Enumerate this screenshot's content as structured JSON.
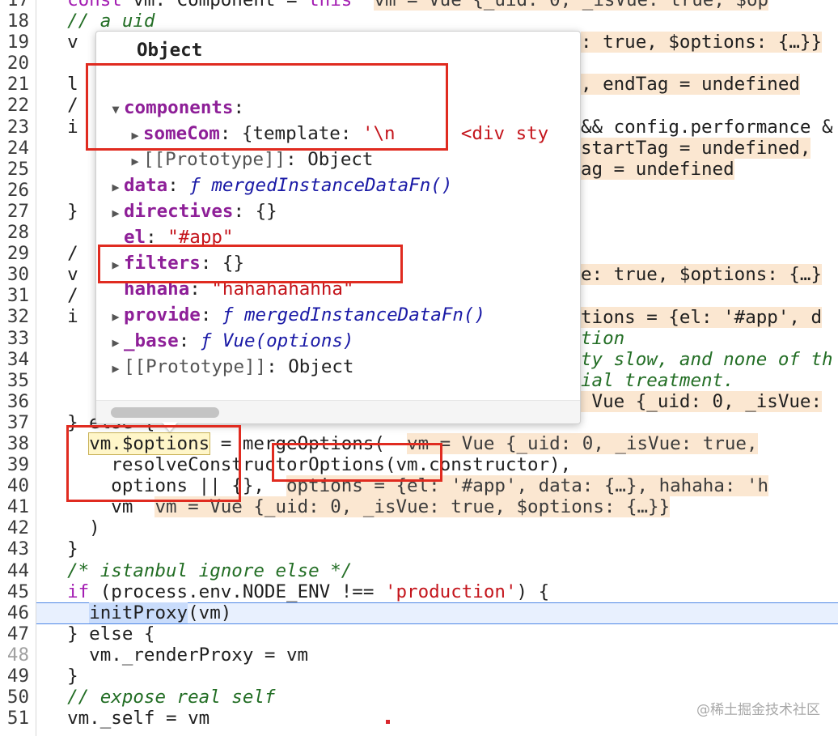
{
  "code_lines": [
    {
      "n": "17",
      "parts": [
        [
          "t",
          "  "
        ],
        [
          "kw",
          "const"
        ],
        [
          "t",
          " vm: Component = "
        ],
        [
          "kw",
          "this"
        ],
        [
          "t",
          "  "
        ],
        [
          "inl",
          "vm = Vue {_uid: 0, _isVue: true, $op"
        ]
      ]
    },
    {
      "n": "18",
      "parts": [
        [
          "cm",
          "  // a uid"
        ]
      ]
    },
    {
      "n": "19",
      "parts": [
        [
          "t",
          "  v"
        ]
      ]
    },
    {
      "n": "20",
      "parts": []
    },
    {
      "n": "21",
      "parts": [
        [
          "t",
          "  l"
        ]
      ]
    },
    {
      "n": "22",
      "parts": [
        [
          "t",
          "  /"
        ]
      ]
    },
    {
      "n": "23",
      "parts": [
        [
          "t",
          "  i"
        ]
      ]
    },
    {
      "n": "24",
      "parts": []
    },
    {
      "n": "25",
      "parts": []
    },
    {
      "n": "26",
      "parts": []
    },
    {
      "n": "27",
      "parts": [
        [
          "t",
          "  }"
        ]
      ]
    },
    {
      "n": "28",
      "parts": []
    },
    {
      "n": "29",
      "parts": [
        [
          "t",
          "  /"
        ]
      ]
    },
    {
      "n": "30",
      "parts": [
        [
          "t",
          "  v"
        ]
      ]
    },
    {
      "n": "31",
      "parts": [
        [
          "t",
          "  /"
        ]
      ]
    },
    {
      "n": "32",
      "parts": [
        [
          "t",
          "  i"
        ]
      ]
    },
    {
      "n": "33",
      "parts": []
    },
    {
      "n": "34",
      "parts": []
    },
    {
      "n": "35",
      "parts": []
    },
    {
      "n": "36",
      "parts": []
    },
    {
      "n": "37",
      "parts": [
        [
          "t",
          "  } else {"
        ]
      ]
    },
    {
      "n": "38",
      "parts": [
        [
          "t",
          "    "
        ],
        [
          "hw",
          "vm.$options"
        ],
        [
          "t",
          " = mergeOptions(  "
        ],
        [
          "inl",
          "vm = Vue {_uid: 0, _isVue: true,"
        ]
      ]
    },
    {
      "n": "39",
      "parts": [
        [
          "t",
          "      resolveConstructorOptions(vm.constructor),"
        ]
      ]
    },
    {
      "n": "40",
      "parts": [
        [
          "t",
          "      options || {},  "
        ],
        [
          "inl",
          "options = {el: '#app', data: {…}, hahaha: 'h"
        ]
      ]
    },
    {
      "n": "41",
      "parts": [
        [
          "t",
          "      vm  "
        ],
        [
          "inl",
          "vm = Vue {_uid: 0, _isVue: true, $options: {…}}"
        ]
      ]
    },
    {
      "n": "42",
      "parts": [
        [
          "t",
          "    )"
        ]
      ]
    },
    {
      "n": "43",
      "parts": [
        [
          "t",
          "  }"
        ]
      ]
    },
    {
      "n": "44",
      "parts": [
        [
          "cm",
          "  /* istanbul ignore else */"
        ]
      ]
    },
    {
      "n": "45",
      "parts": [
        [
          "t",
          "  "
        ],
        [
          "kw",
          "if"
        ],
        [
          "t",
          " (process.env.NODE_ENV !== "
        ],
        [
          "str",
          "'production'"
        ],
        [
          "t",
          ") {"
        ]
      ]
    },
    {
      "n": "46",
      "parts": [
        [
          "t",
          "    "
        ],
        [
          "ex",
          "initProxy"
        ],
        [
          "t",
          "(vm)"
        ]
      ]
    },
    {
      "n": "47",
      "parts": [
        [
          "t",
          "  } else {"
        ]
      ]
    },
    {
      "n": "48",
      "parts": [
        [
          "t",
          "    vm._renderProxy = vm"
        ]
      ]
    },
    {
      "n": "49",
      "parts": [
        [
          "t",
          "  }"
        ]
      ]
    },
    {
      "n": "50",
      "parts": [
        [
          "cm",
          "  // expose real self"
        ]
      ]
    },
    {
      "n": "51",
      "parts": [
        [
          "t",
          "  vm._self = vm"
        ]
      ]
    }
  ],
  "side_fragments": [
    {
      "line": 19,
      "col": "right",
      "text": ": true, $options: {…}}"
    },
    {
      "line": 21,
      "col": "right",
      "text": ", endTag = undefined"
    },
    {
      "line": 23,
      "col": "right",
      "text": "&& config.performance &"
    },
    {
      "line": 24,
      "col": "right",
      "text": "startTag = undefined,"
    },
    {
      "line": 25,
      "col": "right",
      "text": "ag = undefined"
    },
    {
      "line": 30,
      "col": "right",
      "text": "e: true, $options: {…}"
    },
    {
      "line": 32,
      "col": "right",
      "text": "tions = {el: '#app', d"
    },
    {
      "line": 33,
      "col": "right",
      "text": "tion"
    },
    {
      "line": 34,
      "col": "right",
      "text": "ty slow, and none of th"
    },
    {
      "line": 35,
      "col": "right",
      "text": "ial treatment."
    },
    {
      "line": 36,
      "col": "right",
      "text": " Vue {_uid: 0, _isVue:"
    }
  ],
  "popover": {
    "title": "Object",
    "rows": [
      {
        "tri": "▼",
        "key": "components",
        "sep": ":",
        "val": "",
        "indent": 0,
        "kind": "key"
      },
      {
        "tri": "▶",
        "key": "someCom",
        "sep": ": ",
        "val": "{template: '\\n      <div sty",
        "indent": 1,
        "kind": "key"
      },
      {
        "tri": "▶",
        "key": "[[Prototype]]",
        "sep": ": ",
        "val": "Object",
        "indent": 1,
        "kind": "dim"
      },
      {
        "tri": "▶",
        "key": "data",
        "sep": ": ",
        "val": "ƒ mergedInstanceDataFn()",
        "indent": 0,
        "kind": "fn"
      },
      {
        "tri": "▶",
        "key": "directives",
        "sep": ": ",
        "val": "{}",
        "indent": 0,
        "kind": "key"
      },
      {
        "tri": "",
        "key": "el",
        "sep": ": ",
        "val": "\"#app\"",
        "indent": 0,
        "kind": "str"
      },
      {
        "tri": "▶",
        "key": "filters",
        "sep": ": ",
        "val": "{}",
        "indent": 0,
        "kind": "key"
      },
      {
        "tri": "",
        "key": "hahaha",
        "sep": ": ",
        "val": "\"hahahahahha\"",
        "indent": 0,
        "kind": "str"
      },
      {
        "tri": "▶",
        "key": "provide",
        "sep": ": ",
        "val": "ƒ mergedInstanceDataFn()",
        "indent": 0,
        "kind": "fn"
      },
      {
        "tri": "▶",
        "key": "_base",
        "sep": ": ",
        "val": "ƒ Vue(options)",
        "indent": 0,
        "kind": "fn"
      },
      {
        "tri": "▶",
        "key": "[[Prototype]]",
        "sep": ": ",
        "val": "Object",
        "indent": 0,
        "kind": "dim"
      }
    ]
  },
  "watermark": "@稀土掘金技术社区",
  "colors": {
    "annotation_red": "#e02b20",
    "exec_highlight": "#e8f0fe",
    "inline_value_bg": "#fbe7d1"
  }
}
